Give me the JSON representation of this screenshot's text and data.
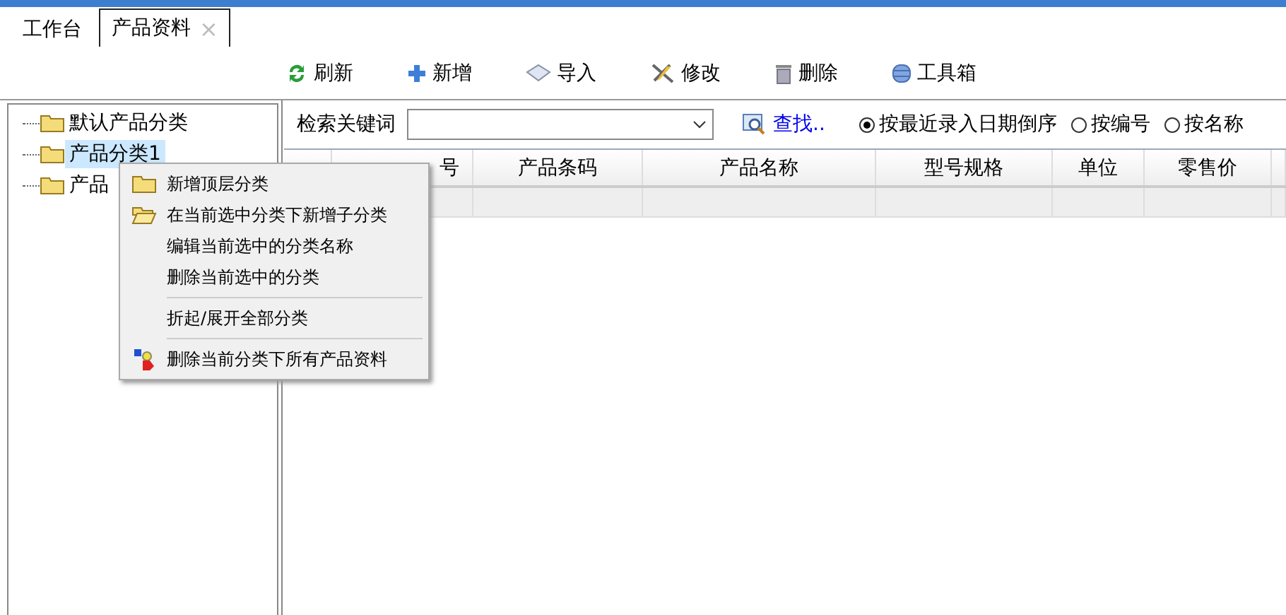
{
  "tabs": [
    {
      "label": "工作台",
      "selected": false
    },
    {
      "label": "产品资料",
      "selected": true,
      "close": "×"
    }
  ],
  "toolbar": [
    {
      "label": "刷新"
    },
    {
      "label": "新增"
    },
    {
      "label": "导入"
    },
    {
      "label": "修改"
    },
    {
      "label": "删除"
    },
    {
      "label": "工具箱"
    }
  ],
  "tree": [
    {
      "label": "默认产品分类",
      "selected": false
    },
    {
      "label": "产品分类1",
      "selected": true
    },
    {
      "label": "产品",
      "selected": false
    }
  ],
  "search": {
    "label": "检索关键词",
    "find": "查找..",
    "sort_options": [
      {
        "label": "按最近录入日期倒序",
        "selected": true
      },
      {
        "label": "按编号",
        "selected": false
      },
      {
        "label": "按名称",
        "selected": false
      }
    ]
  },
  "table": {
    "columns": [
      "",
      "号",
      "产品条码",
      "产品名称",
      "型号规格",
      "单位",
      "零售价"
    ]
  },
  "context_menu": [
    {
      "kind": "item",
      "label": "新增顶层分类"
    },
    {
      "kind": "item",
      "label": "在当前选中分类下新增子分类"
    },
    {
      "kind": "item",
      "label": "编辑当前选中的分类名称"
    },
    {
      "kind": "item",
      "label": "删除当前选中的分类"
    },
    {
      "kind": "separator"
    },
    {
      "kind": "item",
      "label": "折起/展开全部分类"
    },
    {
      "kind": "separator"
    },
    {
      "kind": "item",
      "label": "删除当前分类下所有产品资料"
    }
  ]
}
